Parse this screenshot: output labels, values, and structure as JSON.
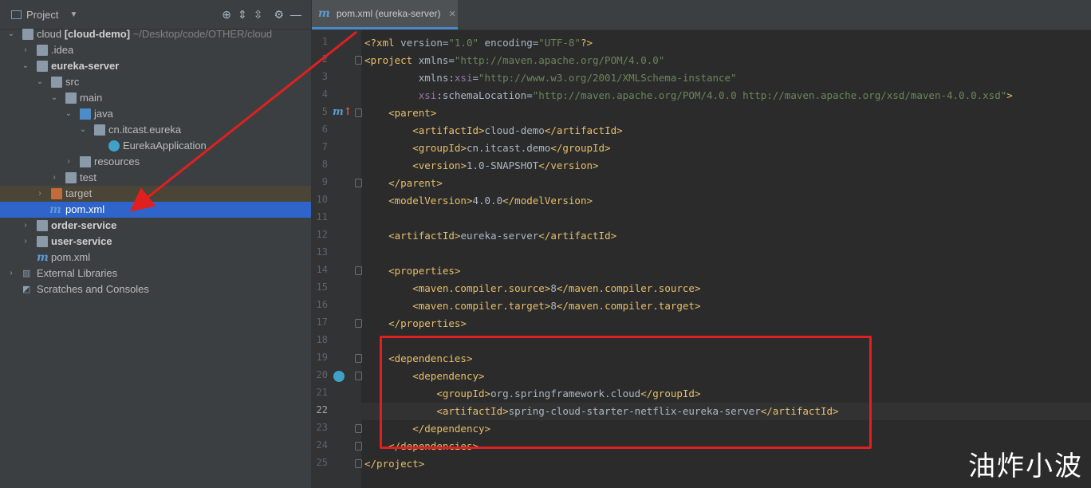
{
  "project_panel": {
    "title": "Project",
    "tree": [
      {
        "label": "cloud",
        "bold_suffix": "[cloud-demo]",
        "path": "~/Desktop/code/OTHER/cloud"
      },
      {
        "label": ".idea"
      },
      {
        "label": "eureka-server"
      },
      {
        "label": "src"
      },
      {
        "label": "main"
      },
      {
        "label": "java"
      },
      {
        "label": "cn.itcast.eureka"
      },
      {
        "label": "EurekaApplication"
      },
      {
        "label": "resources"
      },
      {
        "label": "test"
      },
      {
        "label": "target"
      },
      {
        "label": "pom.xml"
      },
      {
        "label": "order-service"
      },
      {
        "label": "user-service"
      },
      {
        "label": "pom.xml"
      },
      {
        "label": "External Libraries"
      },
      {
        "label": "Scratches and Consoles"
      }
    ]
  },
  "editor": {
    "tab_label": "pom.xml (eureka-server)",
    "current_line": 22,
    "lines": [
      "<?xml version=\"1.0\" encoding=\"UTF-8\"?>",
      "<project xmlns=\"http://maven.apache.org/POM/4.0.0\"",
      "         xmlns:xsi=\"http://www.w3.org/2001/XMLSchema-instance\"",
      "         xsi:schemaLocation=\"http://maven.apache.org/POM/4.0.0 http://maven.apache.org/xsd/maven-4.0.0.xsd\">",
      "    <parent>",
      "        <artifactId>cloud-demo</artifactId>",
      "        <groupId>cn.itcast.demo</groupId>",
      "        <version>1.0-SNAPSHOT</version>",
      "    </parent>",
      "    <modelVersion>4.0.0</modelVersion>",
      "",
      "    <artifactId>eureka-server</artifactId>",
      "",
      "    <properties>",
      "        <maven.compiler.source>8</maven.compiler.source>",
      "        <maven.compiler.target>8</maven.compiler.target>",
      "    </properties>",
      "",
      "    <dependencies>",
      "        <dependency>",
      "            <groupId>org.springframework.cloud</groupId>",
      "            <artifactId>spring-cloud-starter-netflix-eureka-server</artifactId>",
      "        </dependency>",
      "    </dependencies>",
      "</project>"
    ]
  },
  "watermark": "油炸小波",
  "colors": {
    "selection": "#2f65ca",
    "annotation_red": "#e02020",
    "tag": "#e8bf6a",
    "string": "#6a8759"
  }
}
